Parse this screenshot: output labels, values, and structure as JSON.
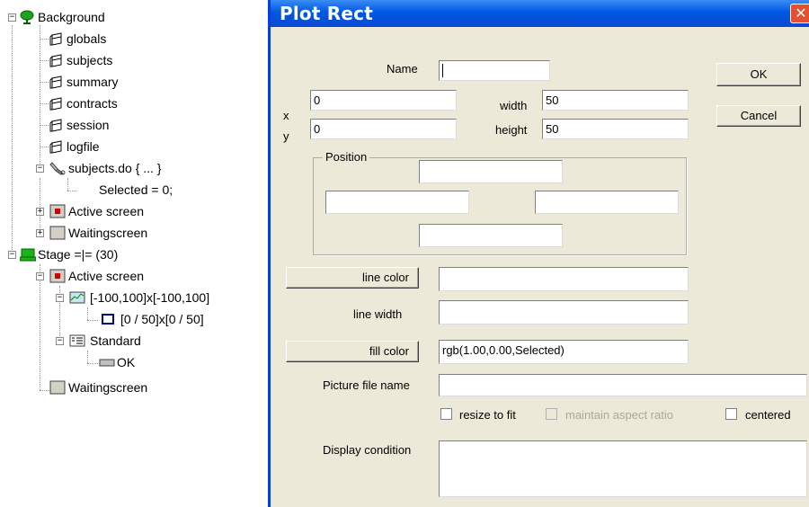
{
  "tree": {
    "items": [
      {
        "label": "Background",
        "icon": "tree-green-icon"
      },
      {
        "label": "globals",
        "icon": "table-icon"
      },
      {
        "label": "subjects",
        "icon": "table-icon"
      },
      {
        "label": "summary",
        "icon": "table-icon"
      },
      {
        "label": "contracts",
        "icon": "table-icon"
      },
      {
        "label": "session",
        "icon": "table-icon"
      },
      {
        "label": "logfile",
        "icon": "table-icon"
      },
      {
        "label": "subjects.do {  ... }",
        "icon": "wrench-icon"
      },
      {
        "label": "Selected = 0;",
        "icon": ""
      },
      {
        "label": "Active screen",
        "icon": "screen-active-icon"
      },
      {
        "label": "Waitingscreen",
        "icon": "screen-icon"
      },
      {
        "label": "Stage =|= (30)",
        "icon": "stage-icon"
      },
      {
        "label": "Active screen",
        "icon": "screen-active-icon"
      },
      {
        "label": "[-100,100]x[-100,100]",
        "icon": "plot-box-icon"
      },
      {
        "label": "[0 / 50]x[0 / 50]",
        "icon": "rect-icon"
      },
      {
        "label": "Standard",
        "icon": "standard-box-icon"
      },
      {
        "label": "OK",
        "icon": "button-icon"
      },
      {
        "label": "Waitingscreen",
        "icon": "screen-icon"
      }
    ]
  },
  "dialog": {
    "title": "Plot Rect",
    "close_glyph": "✕",
    "name_label": "Name",
    "name_value": "",
    "ok_label": "OK",
    "cancel_label": "Cancel",
    "x_label": "x",
    "x_value": "0",
    "y_label": "y",
    "y_value": "0",
    "width_label": "width",
    "width_value": "50",
    "height_label": "height",
    "height_value": "50",
    "position_label": "Position",
    "line_color_label": "line color",
    "line_color_value": "",
    "line_width_label": "line width",
    "line_width_value": "",
    "fill_color_label": "fill color",
    "fill_color_value": "rgb(1.00,0.00,Selected)",
    "picture_label": "Picture file name",
    "picture_value": "",
    "resize_label": "resize to fit",
    "aspect_label": "maintain aspect ratio",
    "centered_label": "centered",
    "display_condition_label": "Display condition",
    "display_condition_value": ""
  },
  "colors": {
    "titlebar": "#0058e3",
    "dialog_bg": "#ece9d8",
    "close_red": "#e4502f"
  }
}
